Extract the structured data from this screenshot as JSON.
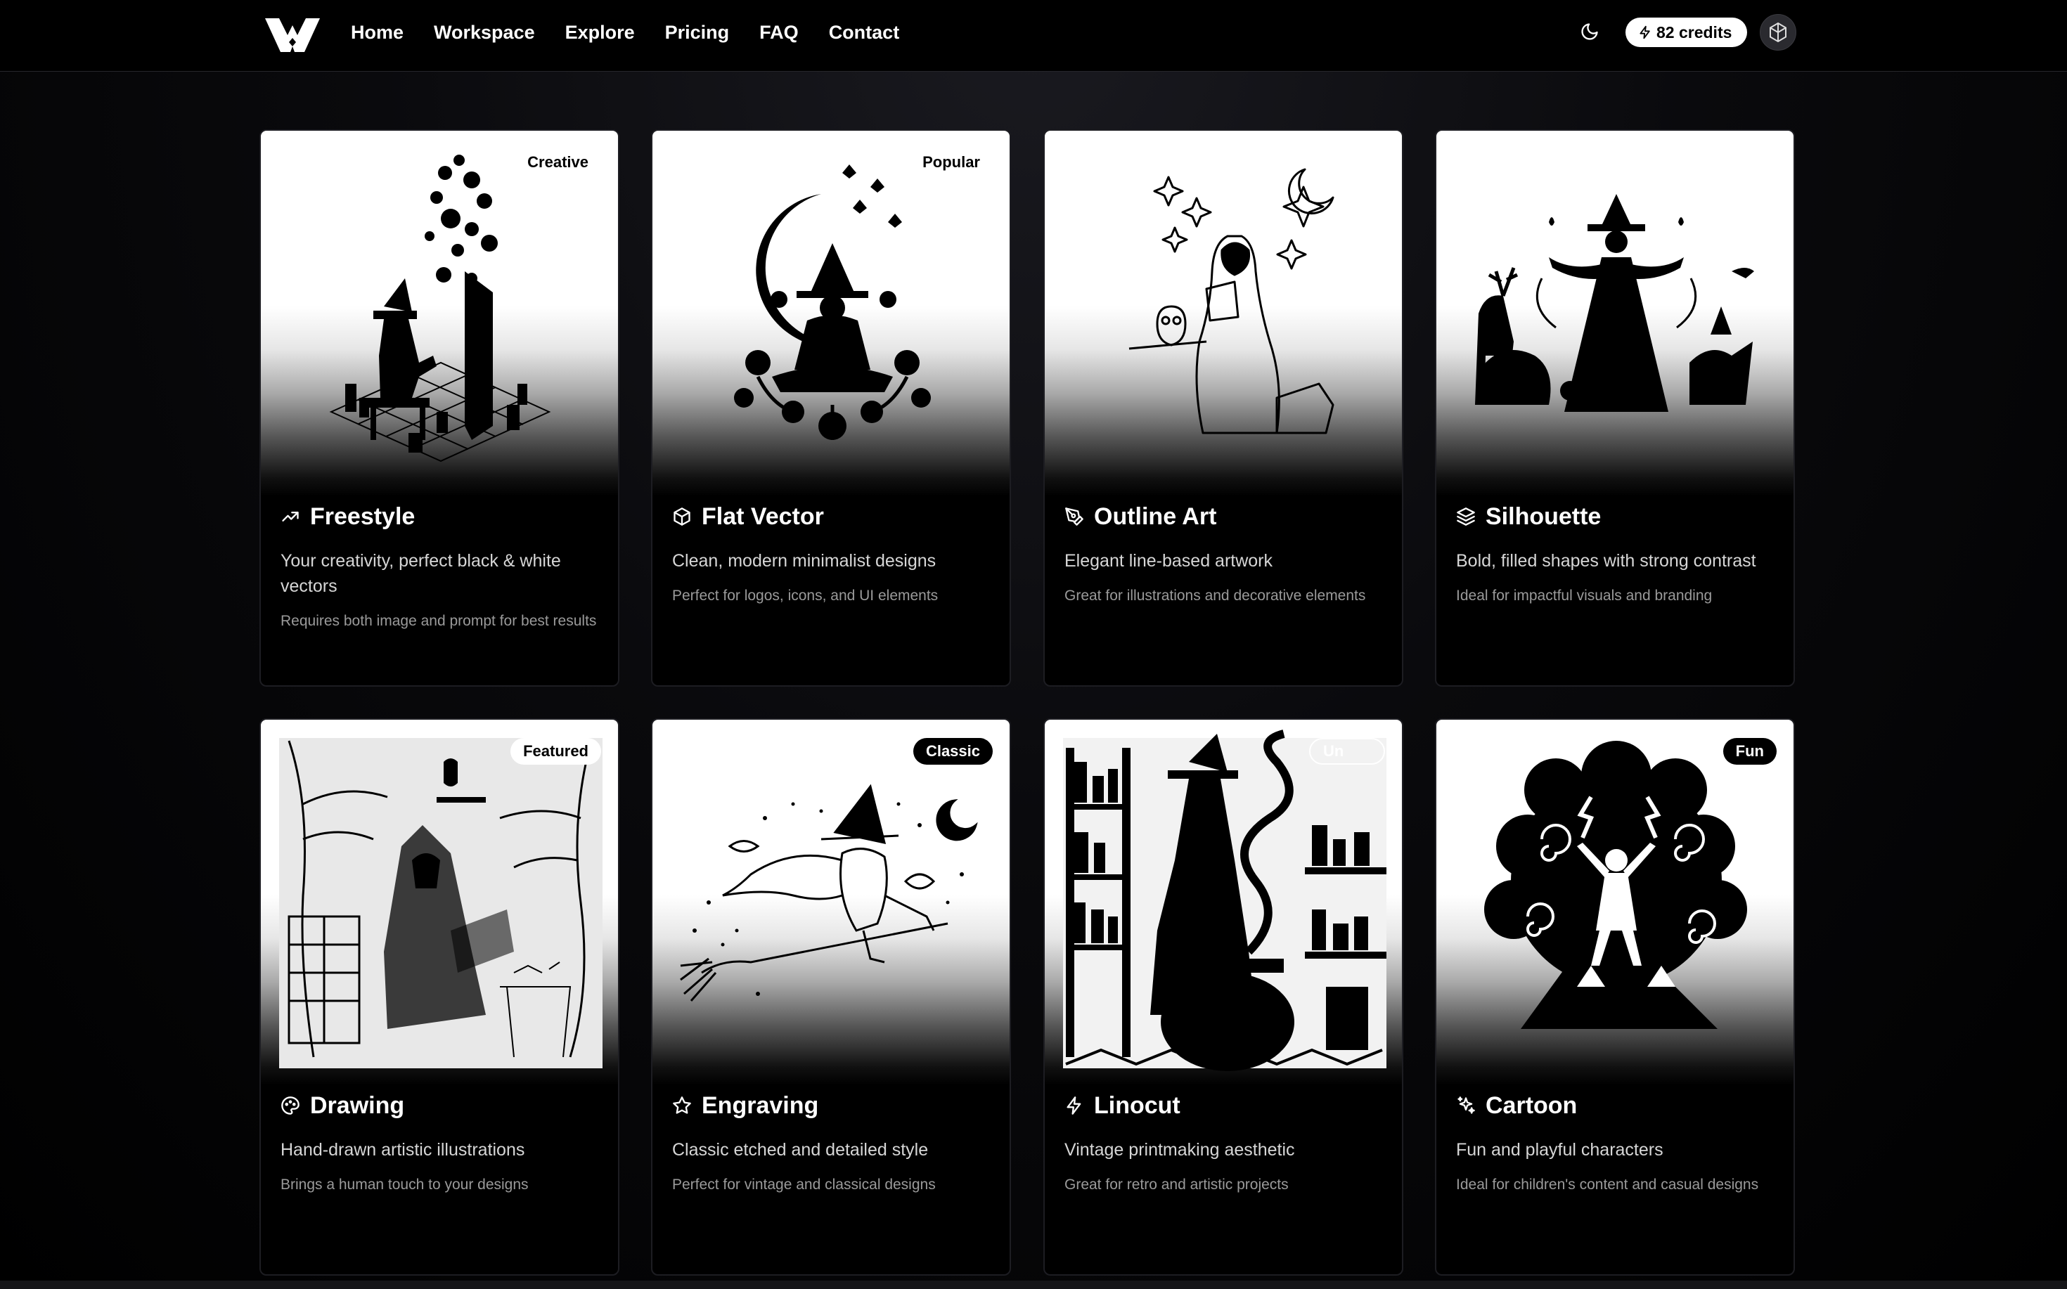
{
  "nav": {
    "links": [
      "Home",
      "Workspace",
      "Explore",
      "Pricing",
      "FAQ",
      "Contact"
    ],
    "credits_label": "82 credits",
    "logo_icon": "w-logo-icon",
    "theme_icon": "moon-icon",
    "avatar_icon": "openai-avatar-icon"
  },
  "cards": [
    {
      "title": "Freestyle",
      "icon": "trending-up-icon",
      "badge": "Creative",
      "badge_style": "light",
      "description": "Your creativity, perfect black & white vectors",
      "note": "Requires both image and prompt for best results"
    },
    {
      "title": "Flat Vector",
      "icon": "box-icon",
      "badge": "Popular",
      "badge_style": "light",
      "description": "Clean, modern minimalist designs",
      "note": "Perfect for logos, icons, and UI elements"
    },
    {
      "title": "Outline Art",
      "icon": "pen-tool-icon",
      "badge": "",
      "badge_style": "none",
      "description": "Elegant line-based artwork",
      "note": "Great for illustrations and decorative elements"
    },
    {
      "title": "Silhouette",
      "icon": "layers-icon",
      "badge": "",
      "badge_style": "none",
      "description": "Bold, filled shapes with strong contrast",
      "note": "Ideal for impactful visuals and branding"
    },
    {
      "title": "Drawing",
      "icon": "palette-icon",
      "badge": "Featured",
      "badge_style": "light",
      "description": "Hand-drawn artistic illustrations",
      "note": "Brings a human touch to your designs"
    },
    {
      "title": "Engraving",
      "icon": "star-icon",
      "badge": "Classic",
      "badge_style": "dark",
      "description": "Classic etched and detailed style",
      "note": "Perfect for vintage and classical designs"
    },
    {
      "title": "Linocut",
      "icon": "zap-icon",
      "badge": "Un",
      "badge_style": "outline",
      "description": "Vintage printmaking aesthetic",
      "note": "Great for retro and artistic projects"
    },
    {
      "title": "Cartoon",
      "icon": "sparkles-icon",
      "badge": "Fun",
      "badge_style": "dark",
      "description": "Fun and playful characters",
      "note": "Ideal for children's content and casual designs"
    }
  ]
}
